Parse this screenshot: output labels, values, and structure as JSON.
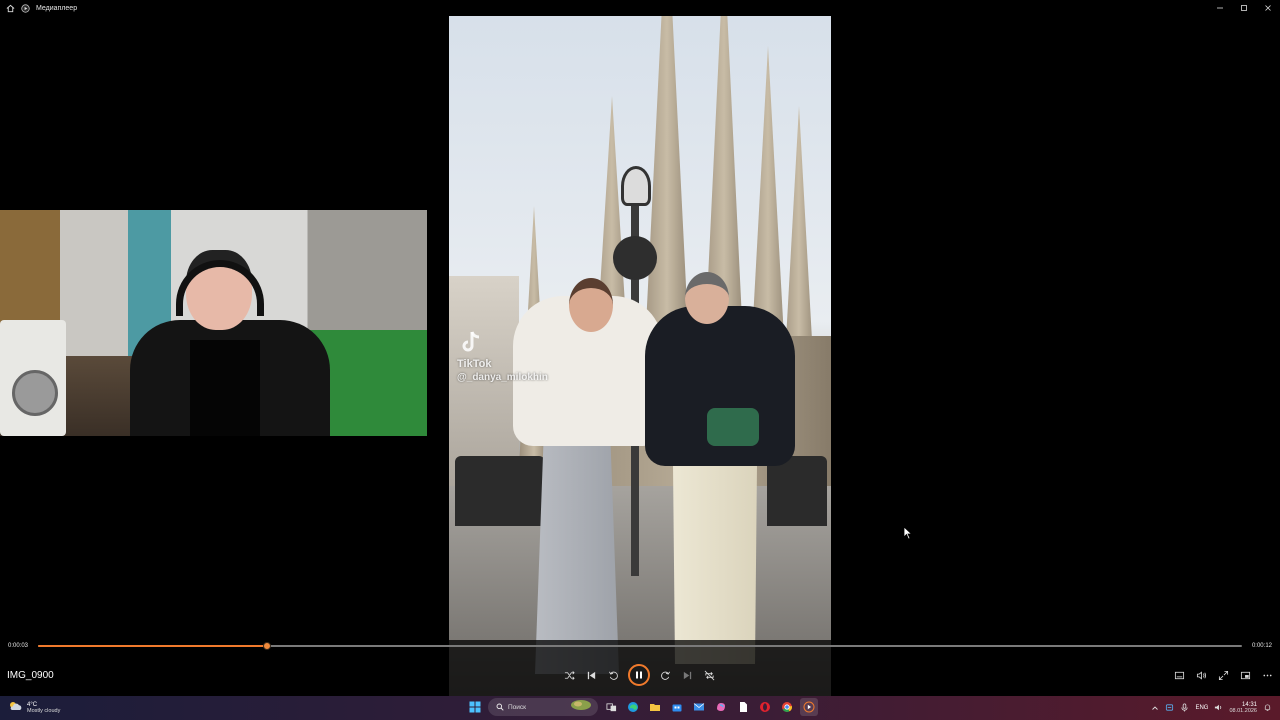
{
  "window": {
    "title": "Медиаплеер"
  },
  "video": {
    "watermark_label": "TikTok",
    "watermark_handle": "@_danya_milokhin"
  },
  "player": {
    "current_time": "0:00:03",
    "total_time": "0:00:12",
    "progress": 0.19,
    "track_name": "IMG_0900",
    "accent_color": "#f07a2c",
    "state": "playing"
  },
  "taskbar": {
    "weather_temp": "4°C",
    "weather_desc": "Mostly cloudy",
    "search_label": "Поиск",
    "language": "ENG",
    "time": "14:31",
    "date": "08.01.2026"
  }
}
